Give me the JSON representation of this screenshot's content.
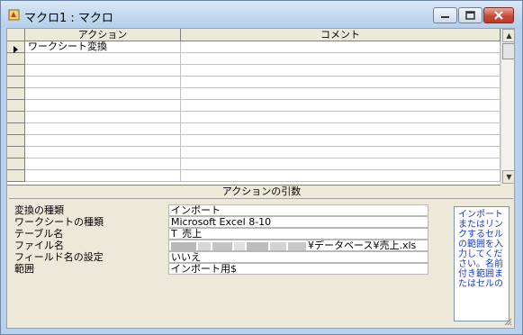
{
  "window": {
    "title": "マクロ1 : マクロ"
  },
  "grid": {
    "columns": [
      "アクション",
      "コメント"
    ],
    "rows": [
      {
        "action": "ワークシート変換",
        "comment": "",
        "current": true
      },
      {
        "action": "",
        "comment": ""
      },
      {
        "action": "",
        "comment": ""
      },
      {
        "action": "",
        "comment": ""
      },
      {
        "action": "",
        "comment": ""
      },
      {
        "action": "",
        "comment": ""
      },
      {
        "action": "",
        "comment": ""
      },
      {
        "action": "",
        "comment": ""
      },
      {
        "action": "",
        "comment": ""
      },
      {
        "action": "",
        "comment": ""
      },
      {
        "action": "",
        "comment": ""
      },
      {
        "action": "",
        "comment": ""
      }
    ]
  },
  "arguments": {
    "section_title": "アクションの引数",
    "items": [
      {
        "label": "変換の種類",
        "value": "インポート"
      },
      {
        "label": "ワークシートの種類",
        "value": "Microsoft Excel 8-10"
      },
      {
        "label": "テーブル名",
        "value": "T_売上"
      },
      {
        "label": "ファイル名",
        "value": "¥データベース¥売上.xls"
      },
      {
        "label": "フィールド名の設定",
        "value": "いいえ"
      },
      {
        "label": "範囲",
        "value": "インポート用$"
      }
    ],
    "help_text": "インポートまたはリンクするセルの範囲を入力してください。名前付き範囲またはセルの"
  },
  "colors": {
    "help_text": "#1a3cc8",
    "close_button": "#c74a36"
  }
}
